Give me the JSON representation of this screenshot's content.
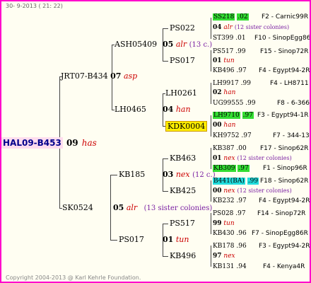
{
  "header": {
    "date": "30- 9-2013 ( 21: 22)"
  },
  "footer": {
    "copyright": "Copyright 2004-2013 @ Karl Kehrle Foundation."
  },
  "root": {
    "name": "HAL09-B453",
    "num": "09",
    "race": "has"
  },
  "gen1": {
    "sire": {
      "name": "JRT07-B434",
      "num": "07",
      "race": "asp"
    },
    "dam": {
      "name": "SK0524",
      "num": "05",
      "race": "alr",
      "sisters": "(13 sister colonies)"
    }
  },
  "gen2": {
    "ash": {
      "name": "ASH05409",
      "num": "05",
      "race": "alr",
      "sisters": "(13 c.)"
    },
    "lh": {
      "name": "LH0465",
      "num": "04",
      "race": "han"
    },
    "kb": {
      "name": "KB185",
      "num": "03",
      "race": "nex",
      "sisters": "(12 c.)"
    },
    "ps": {
      "name": "PS017",
      "num": "01",
      "race": "tun"
    }
  },
  "gen3": {
    "a": "PS022",
    "b": "PS017",
    "c": "LH0261",
    "d": "KDK0004",
    "e": "KB463",
    "f": "KB425",
    "g": "PS517",
    "h": "KB496"
  },
  "gen4": [
    {
      "name": "SS218",
      "yr": ".02",
      "reg": "F2 - Carnic99R"
    },
    {
      "num": "04",
      "race": "alr",
      "sisters": "(12 sister colonies)"
    },
    {
      "name": "ST399",
      "yr": ".01",
      "reg": "F10 - SinopEgg86R"
    },
    {
      "name": "PS517",
      "yr": ".99",
      "reg": "F15 - Sinop72R"
    },
    {
      "num": "01",
      "race": "tun"
    },
    {
      "name": "KB496",
      "yr": ".97",
      "reg": "F4 - Egypt94-2R"
    },
    {
      "name": "LH9917",
      "yr": ".99",
      "reg": "F4 - LH8711"
    },
    {
      "num": "02",
      "race": "han"
    },
    {
      "name": "UG99555",
      "yr": ".99",
      "reg": "F8 - 6-366"
    },
    {
      "name": "LH9710",
      "yr": ".97",
      "reg": "F3 - Egypt94-1R"
    },
    {
      "num": "00",
      "race": "han"
    },
    {
      "name": "KH9752",
      "yr": ".97",
      "reg": "F7 - 344-13"
    },
    {
      "name": "KB387",
      "yr": ".00",
      "reg": "F17 - Sinop62R"
    },
    {
      "num": "01",
      "race": "nex",
      "sisters": "(12 sister colonies)"
    },
    {
      "name": "KB309",
      "yr": ".97",
      "reg": "F1 - Sinop96R"
    },
    {
      "name": "B441(BA)",
      "yr": ".99",
      "reg": "F18 - Sinop62R"
    },
    {
      "num": "00",
      "race": "nex",
      "sisters": "(12 sister colonies)"
    },
    {
      "name": "KB232",
      "yr": ".97",
      "reg": "F4 - Egypt94-2R"
    },
    {
      "name": "PS028",
      "yr": ".97",
      "reg": "F14 - Sinop72R"
    },
    {
      "num": "99",
      "race": "tun"
    },
    {
      "name": "KB430",
      "yr": ".96",
      "reg": "F7 - SinopEgg86R"
    },
    {
      "name": "KB178",
      "yr": ".96",
      "reg": "F3 - Egypt94-2R"
    },
    {
      "num": "97",
      "race": "nex"
    },
    {
      "name": "KB131",
      "yr": ".94",
      "reg": "F4 - Kenya4R"
    }
  ]
}
